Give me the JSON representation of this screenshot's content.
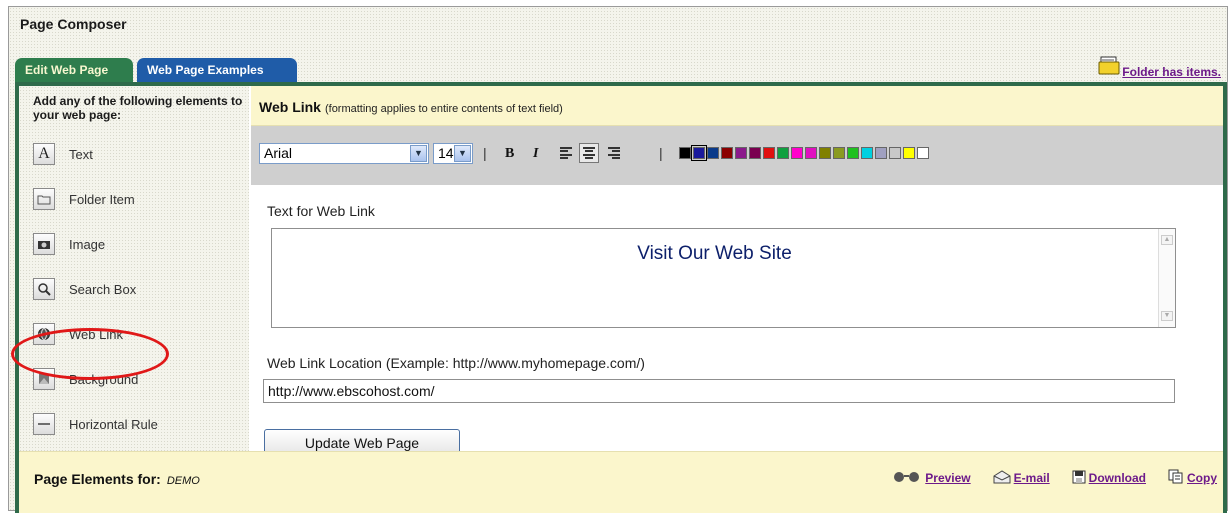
{
  "app": {
    "title": "Page Composer"
  },
  "tabs": [
    {
      "label": "Edit Web Page",
      "active": true
    },
    {
      "label": "Web Page Examples",
      "active": false
    }
  ],
  "folder_notice": {
    "label": "Folder has items.",
    "icon": "folder-stack-icon"
  },
  "sidebar": {
    "title": "Add any of the following elements to your web page:",
    "items": [
      {
        "label": "Text",
        "icon": "letter-a-icon"
      },
      {
        "label": "Folder Item",
        "icon": "folder-icon"
      },
      {
        "label": "Image",
        "icon": "camera-icon"
      },
      {
        "label": "Search Box",
        "icon": "magnifier-icon"
      },
      {
        "label": "Web Link",
        "icon": "globe-link-icon",
        "highlighted": true
      },
      {
        "label": "Background",
        "icon": "background-icon"
      },
      {
        "label": "Horizontal Rule",
        "icon": "horizontal-rule-icon"
      }
    ]
  },
  "editor": {
    "title": "Web Link",
    "note": "(formatting applies to entire contents of text field)",
    "toolbar": {
      "font": "Arial",
      "size": "14",
      "bold": "B",
      "italic": "I",
      "separator": "|",
      "colors": [
        "#000000",
        "#1a1a9c",
        "#0a3a8a",
        "#8b0000",
        "#8b1a8b",
        "#7a0050",
        "#e01010",
        "#10a040",
        "#ff00cc",
        "#e010c0",
        "#808000",
        "#8a9a20",
        "#20c020",
        "#00d0e0",
        "#a0a0c0",
        "#c8c8c8",
        "#ffff00",
        "#ffffff"
      ]
    },
    "text_label": "Text for Web Link",
    "text_value": "Visit Our Web Site",
    "location_label": "Web Link Location (Example: http://www.myhomepage.com/)",
    "location_value": "http://www.ebscohost.com/",
    "update_button": "Update Web Page"
  },
  "footer": {
    "title": "Page Elements for:",
    "owner": "DEMO",
    "actions": [
      {
        "label": "Preview",
        "icon": "glasses-icon"
      },
      {
        "label": "E-mail",
        "icon": "envelope-icon"
      },
      {
        "label": "Download",
        "icon": "floppy-disk-icon"
      },
      {
        "label": "Copy",
        "icon": "copy-icon"
      }
    ]
  },
  "colors": {
    "tab_edit": "#2e7d4d",
    "tab_examples": "#1f5ca8",
    "panel_border": "#2e6a4a",
    "header_bg": "#fbf6cc",
    "link": "#6d1a8a",
    "highlight": "#e01818"
  }
}
